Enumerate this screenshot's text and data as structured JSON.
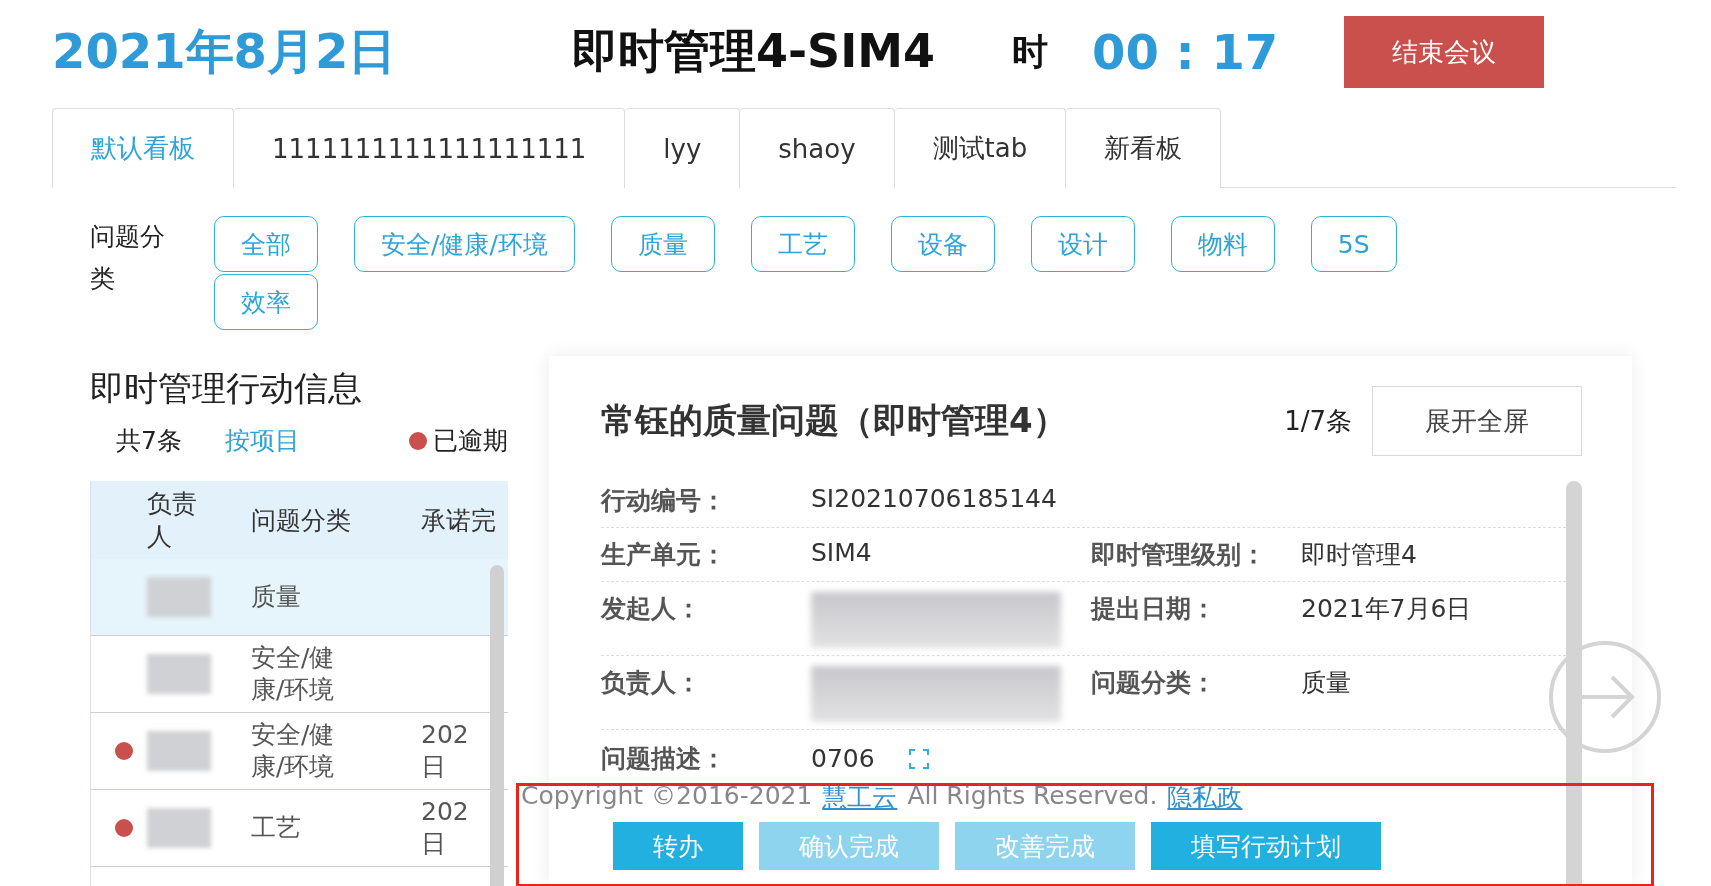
{
  "header": {
    "date": "2021年8月2日",
    "title": "即时管理4-SIM4",
    "timer_label": "时",
    "timer": "00 : 17",
    "end_button": "结束会议"
  },
  "tabs": [
    {
      "label": "默认看板",
      "selected": true
    },
    {
      "label": "1111111111111111111",
      "selected": false
    },
    {
      "label": "lyy",
      "selected": false
    },
    {
      "label": "shaoy",
      "selected": false
    },
    {
      "label": "测试tab",
      "selected": false
    },
    {
      "label": "新看板",
      "selected": false
    }
  ],
  "category_filter": {
    "label": "问题分类",
    "options": [
      "全部",
      "安全/健康/环境",
      "质量",
      "工艺",
      "设备",
      "设计",
      "物料",
      "5S",
      "效率"
    ]
  },
  "action_list": {
    "title": "即时管理行动信息",
    "count": "共7条",
    "group_by": "按项目",
    "legend": "已逾期",
    "columns": [
      "负责人",
      "问题分类",
      "承诺完"
    ],
    "rows": [
      {
        "overdue": false,
        "selected": true,
        "category": "质量"
      },
      {
        "overdue": false,
        "selected": false,
        "category": "安全/健康/环境"
      },
      {
        "overdue": true,
        "selected": false,
        "category": "安全/健康/环境",
        "date": "202日"
      },
      {
        "overdue": true,
        "selected": false,
        "category": "工艺",
        "date": "202日"
      }
    ]
  },
  "detail": {
    "title": "常钰的质量问题（即时管理4）",
    "pager": "1/7条",
    "fullscreen_button": "展开全屏",
    "rows": [
      [
        {
          "label": "行动编号：",
          "value": "SI20210706185144"
        }
      ],
      [
        {
          "label": "生产单元：",
          "value": "SIM4"
        },
        {
          "label": "即时管理级别：",
          "value": "即时管理4"
        }
      ],
      [
        {
          "label": "发起人：",
          "kind": "redacted"
        },
        {
          "label": "提出日期：",
          "value": "2021年7月6日"
        }
      ],
      [
        {
          "label": "负责人：",
          "kind": "redacted"
        },
        {
          "label": "问题分类：",
          "value": "质量"
        }
      ]
    ],
    "description": {
      "label": "问题描述：",
      "value": "0706"
    }
  },
  "footer": {
    "copyright": "Copyright ©2016-2021",
    "brand": "慧工云",
    "rights": "All Rights Reserved.",
    "privacy": "隐私政"
  },
  "actions": [
    {
      "label": "转办",
      "kind": "primary"
    },
    {
      "label": "确认完成",
      "kind": "light"
    },
    {
      "label": "改善完成",
      "kind": "light"
    },
    {
      "label": "填写行动计划",
      "kind": "primary"
    }
  ]
}
